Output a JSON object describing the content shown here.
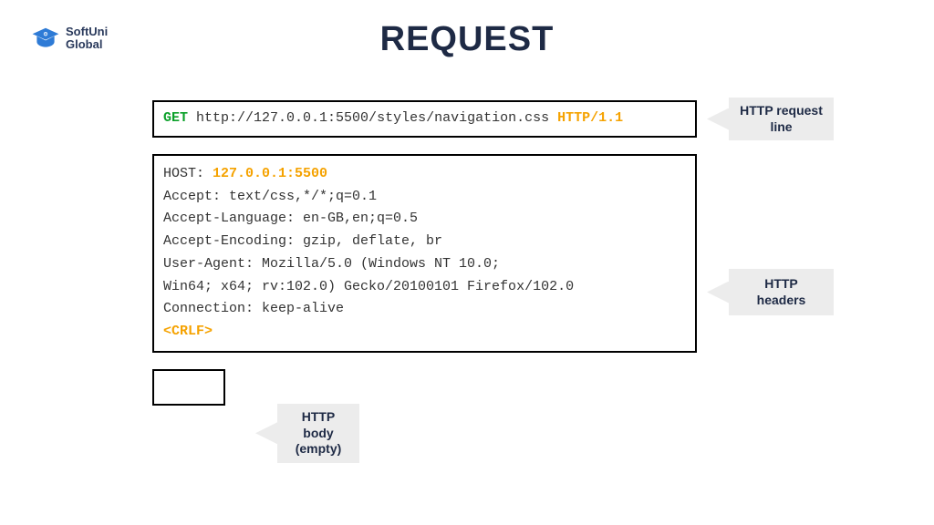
{
  "logo": {
    "line1": "SoftUni",
    "line2": "Global"
  },
  "title": "REQUEST",
  "request_line": {
    "method": "GET",
    "url": "http://127.0.0.1:5500/styles/navigation.css",
    "version": "HTTP/1.1"
  },
  "headers": {
    "host_label": "HOST:",
    "host_value": "127.0.0.1:5500",
    "lines": [
      "Accept: text/css,*/*;q=0.1",
      "Accept-Language: en-GB,en;q=0.5",
      "Accept-Encoding: gzip, deflate, br",
      "User-Agent: Mozilla/5.0 (Windows NT 10.0;",
      "Win64; x64; rv:102.0) Gecko/20100101 Firefox/102.0",
      "Connection: keep-alive"
    ],
    "crlf": "<CRLF>"
  },
  "callouts": {
    "request_line": "HTTP request line",
    "headers": "HTTP headers",
    "body": "HTTP body (empty)"
  }
}
